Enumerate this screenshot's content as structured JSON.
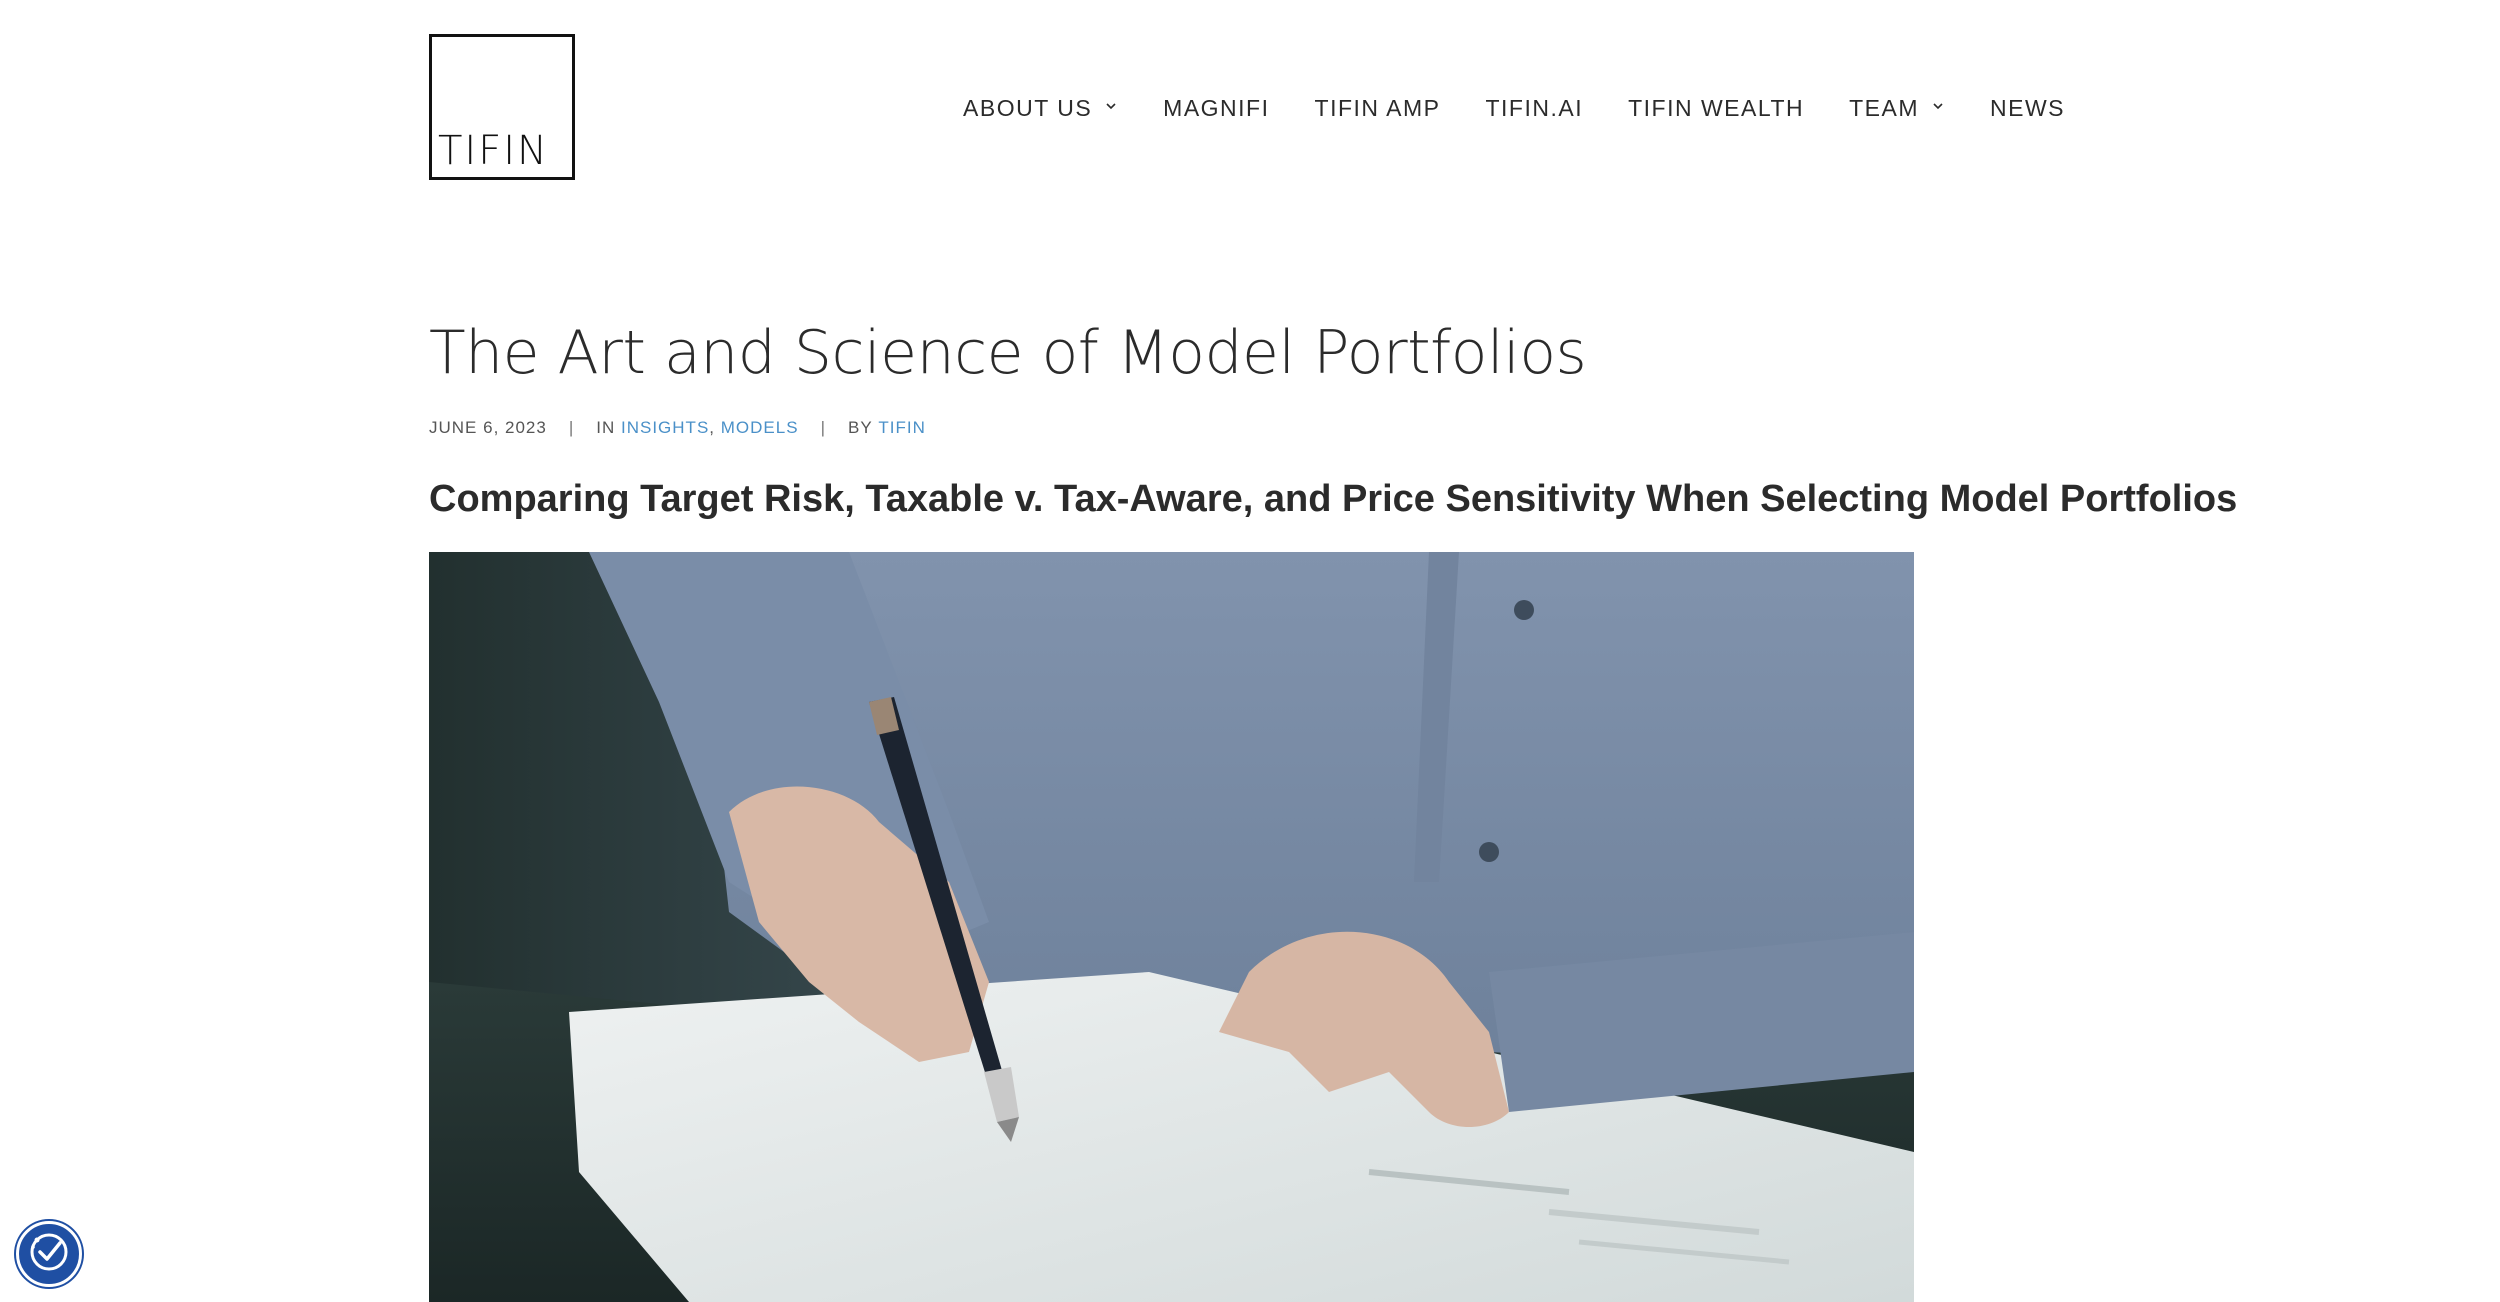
{
  "header": {
    "logo_text": "TIFIN",
    "nav": [
      {
        "label": "ABOUT US",
        "has_dropdown": true
      },
      {
        "label": "MAGNIFI",
        "has_dropdown": false
      },
      {
        "label": "TIFIN AMP",
        "has_dropdown": false
      },
      {
        "label": "TIFIN.AI",
        "has_dropdown": false
      },
      {
        "label": "TIFIN WEALTH",
        "has_dropdown": false
      },
      {
        "label": "TEAM",
        "has_dropdown": true
      },
      {
        "label": "NEWS",
        "has_dropdown": false
      }
    ]
  },
  "post": {
    "title": "The Art and Science of Model Portfolios",
    "meta": {
      "date": "JUNE 6, 2023",
      "separator": "|",
      "in_prefix": "IN",
      "categories": [
        "INSIGHTS",
        "MODELS"
      ],
      "category_joiner": ",",
      "by_prefix": "BY",
      "author": "TIFIN"
    },
    "subtitle": "Comparing Target Risk, Taxable v. Tax-Aware, and Price Sensitivity When Selecting Model Portfolios",
    "featured_image_subject": "person-signing-document"
  },
  "accessibility": {
    "icon": "accessibility-check-icon"
  },
  "colors": {
    "link": "#4a90c8",
    "text": "#2b2b2b",
    "accessibility_button": "#1f4fa3"
  }
}
